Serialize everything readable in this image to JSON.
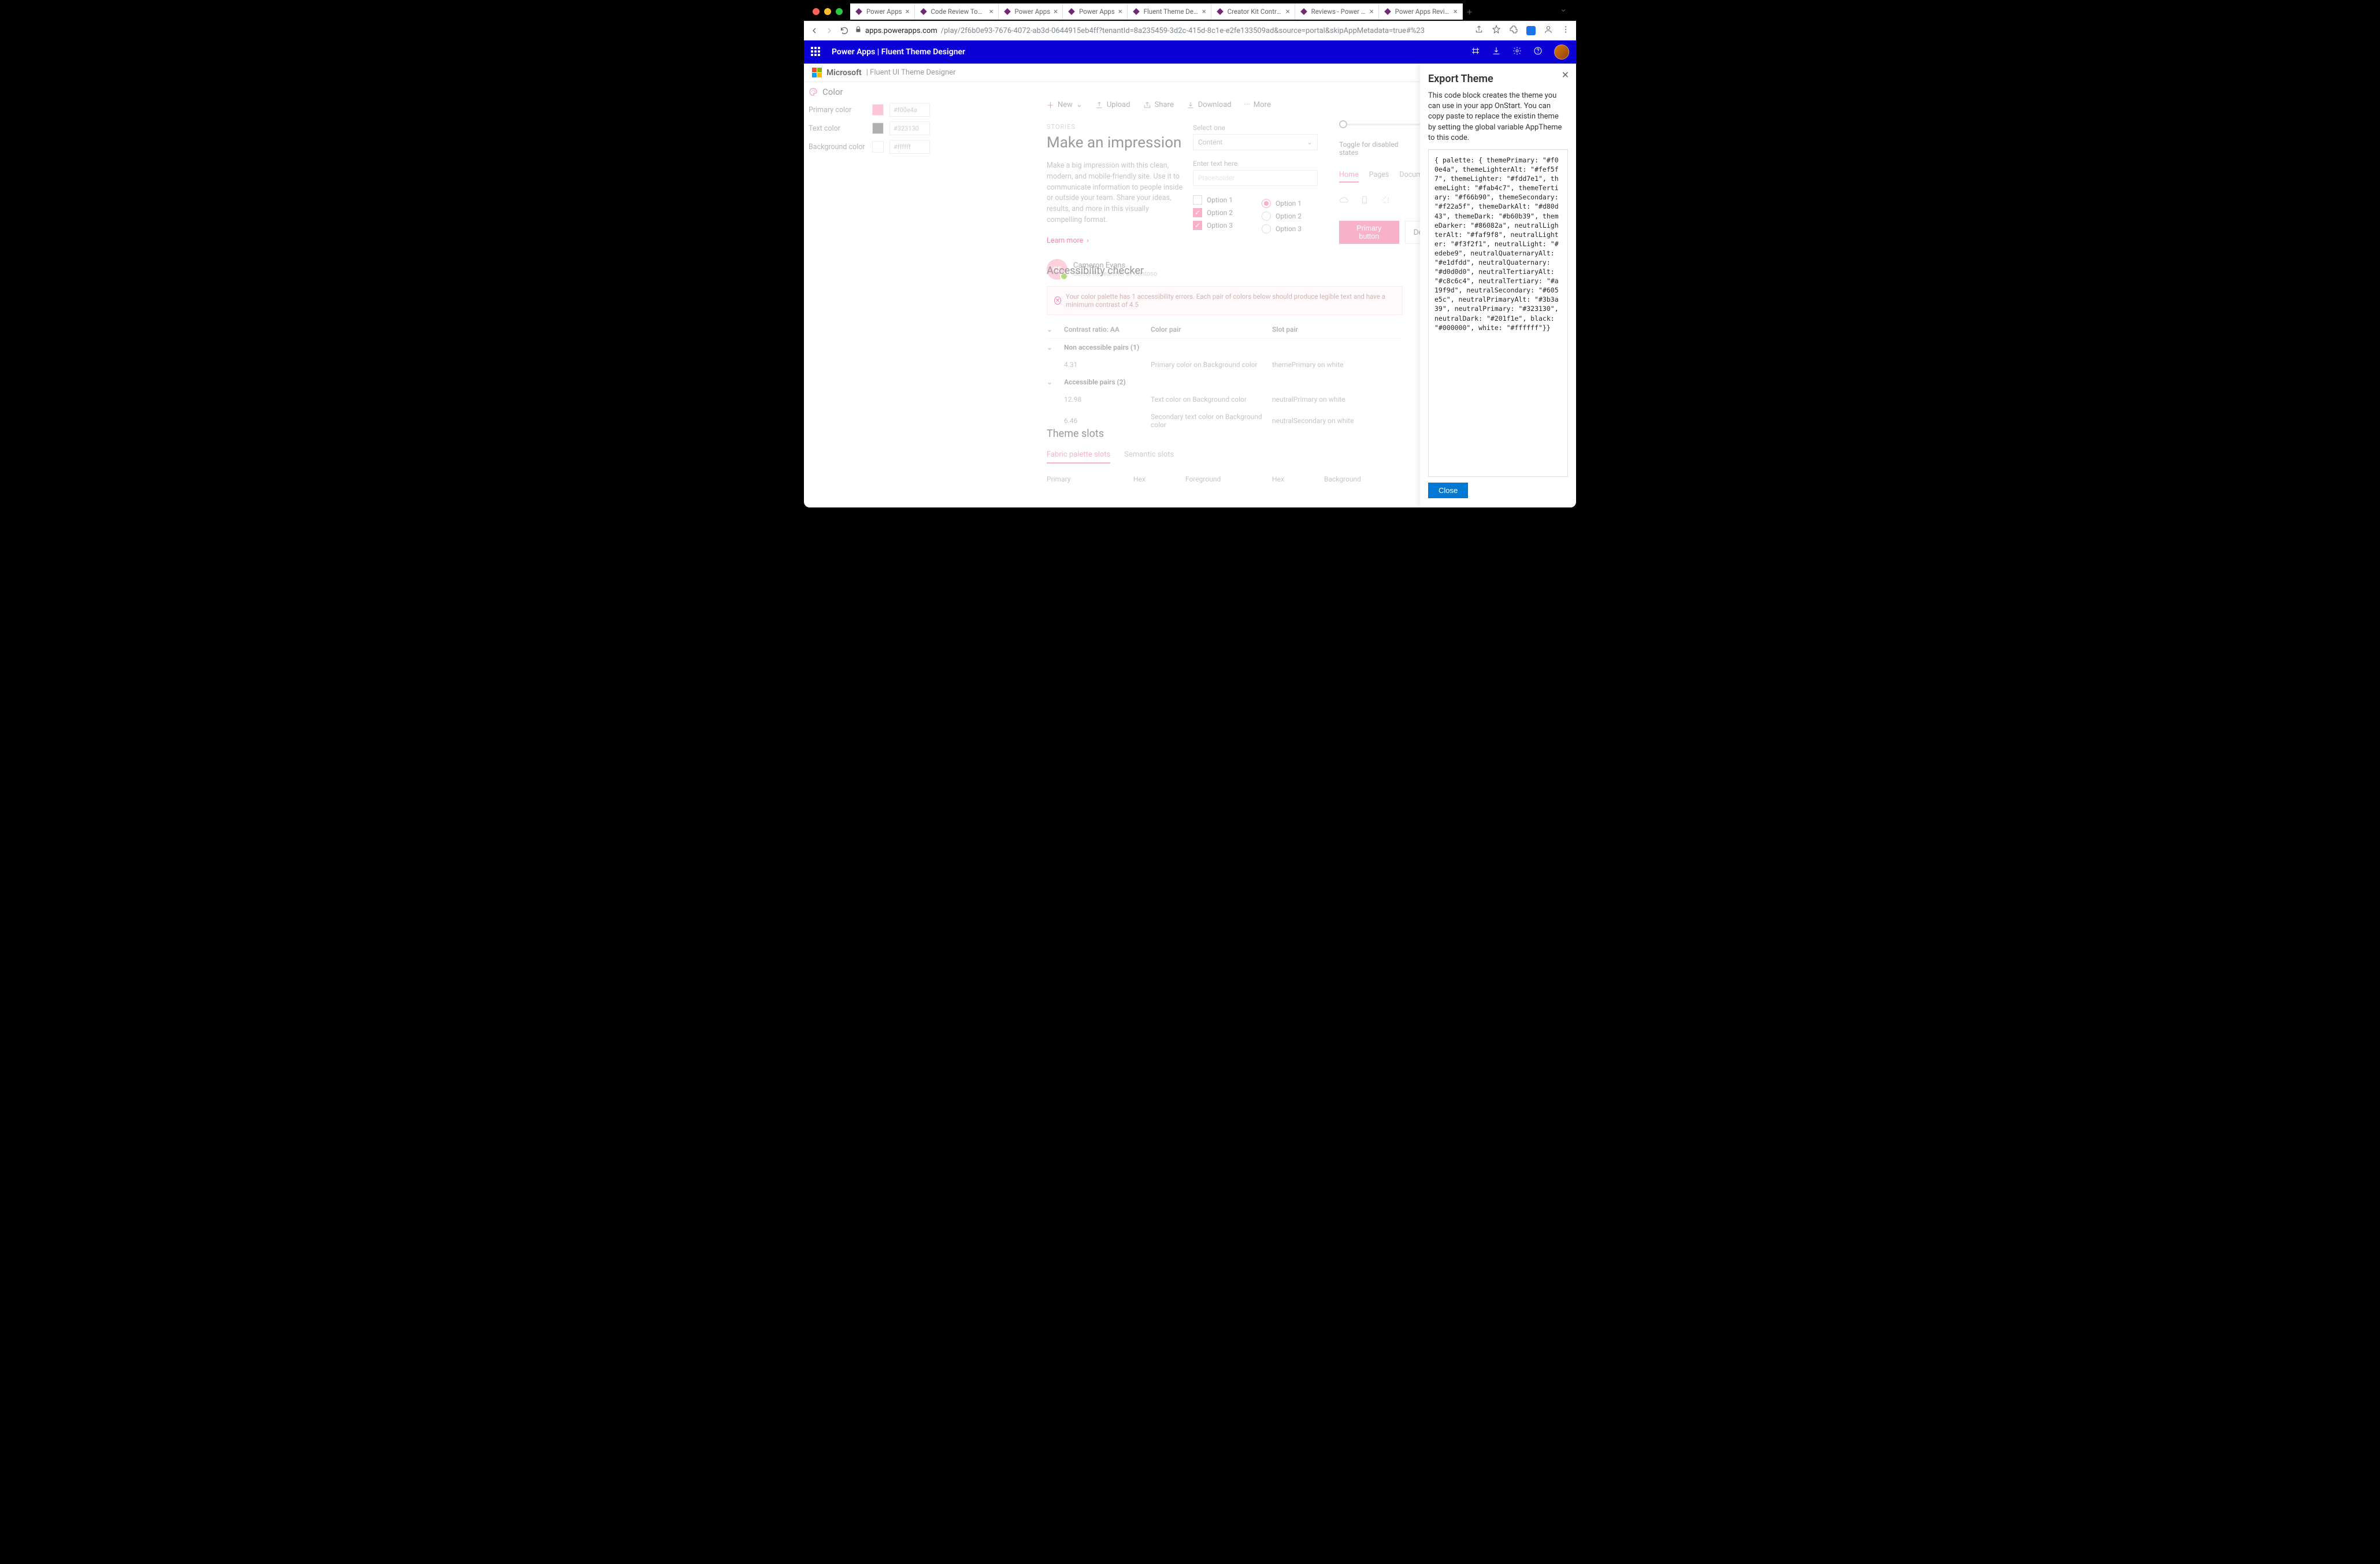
{
  "browser": {
    "tabs": [
      {
        "label": "Power Apps"
      },
      {
        "label": "Code Review Tool Experim"
      },
      {
        "label": "Power Apps"
      },
      {
        "label": "Power Apps"
      },
      {
        "label": "Fluent Theme Designer - P",
        "active": true
      },
      {
        "label": "Creator Kit Control Referen"
      },
      {
        "label": "Reviews - Power Apps"
      },
      {
        "label": "Power Apps Review Tool -"
      }
    ],
    "url_host": "apps.powerapps.com",
    "url_path": "/play/2f6b0e93-7676-4072-ab3d-0644915eb4ff?tenantId=8a235459-3d2c-415d-8c1e-e2fe133509ad&source=portal&skipAppMetadata=true#%23"
  },
  "appbar": {
    "title": "Power Apps  |  Fluent Theme Designer"
  },
  "subheader": {
    "brand": "Microsoft",
    "subtitle": "| Fluent UI Theme Designer"
  },
  "leftpanel": {
    "heading": "Color",
    "rows": [
      {
        "label": "Primary color",
        "hex": "#f00e4a"
      },
      {
        "label": "Text color",
        "hex": "#323130"
      },
      {
        "label": "Background color",
        "hex": "#ffffff"
      }
    ]
  },
  "cmdbar": {
    "new": "New",
    "upload": "Upload",
    "share": "Share",
    "download": "Download",
    "more": "More"
  },
  "demo": {
    "stories": "STORIES",
    "title": "Make an impression",
    "blurb": "Make a big impression with this clean, modern, and mobile-friendly site. Use it to communicate information to people inside or outside your team. Share your ideas, results, and more in this visually compelling format.",
    "learnmore": "Learn more",
    "persona_initials": "CE",
    "persona_name": "Cameron Evans",
    "persona_sub": "Senior Researcher at Contoso",
    "select_label": "Select one",
    "select_value": "Content",
    "text_label": "Enter text here",
    "text_placeholder": "Placeholder",
    "option1": "Option 1",
    "option2": "Option 2",
    "option3": "Option 3",
    "toggle_label": "Toggle for disabled states",
    "pivot": [
      "Home",
      "Pages",
      "Document"
    ],
    "primary_btn": "Primary button",
    "default_btn": "Defa"
  },
  "a11y": {
    "heading": "Accessibility checker",
    "banner": "Your color palette has 1 accessibility errors. Each pair of colors below should produce legible text and have a minimum contrast of 4.5",
    "col_contrast": "Contrast ratio: AA",
    "col_pair": "Color pair",
    "col_slot": "Slot pair",
    "group1": "Non accessible pairs (1)",
    "r1_ratio": "4.31",
    "r1_pair": "Primary color on Background color",
    "r1_slot": "themePrimary on white",
    "group2": "Accessible pairs (2)",
    "r2_ratio": "12.98",
    "r2_pair": "Text color on Background color",
    "r2_slot": "neutralPrimary on white",
    "r3_ratio": "6.46",
    "r3_pair": "Secondary text color on Background color",
    "r3_slot": "neutralSecondary on white"
  },
  "slots": {
    "heading": "Theme slots",
    "tab1": "Fabric palette slots",
    "tab2": "Semantic slots",
    "h1": "Primary",
    "h2": "Hex",
    "h3": "Foreground",
    "h4": "Hex",
    "h5": "Background"
  },
  "export": {
    "title": "Export Theme",
    "desc": "This code block creates the theme you can use in your app OnStart. You can copy paste to replace the existin theme by setting the global variable AppTheme to this code.",
    "code": "{ palette: { themePrimary: \"#f00e4a\", themeLighterAlt: \"#fef5f7\", themeLighter: \"#fdd7e1\", themeLight: \"#fab4c7\", themeTertiary: \"#f66b90\", themeSecondary: \"#f22a5f\", themeDarkAlt: \"#d80d43\", themeDark: \"#b60b39\", themeDarker: \"#86082a\", neutralLighterAlt: \"#faf9f8\", neutralLighter: \"#f3f2f1\", neutralLight: \"#edebe9\", neutralQuaternaryAlt: \"#e1dfdd\", neutralQuaternary: \"#d0d0d0\", neutralTertiaryAlt: \"#c8c6c4\", neutralTertiary: \"#a19f9d\", neutralSecondary: \"#605e5c\", neutralPrimaryAlt: \"#3b3a39\", neutralPrimary: \"#323130\", neutralDark: \"#201f1e\", black: \"#000000\", white: \"#ffffff\"}}",
    "close": "Close"
  }
}
